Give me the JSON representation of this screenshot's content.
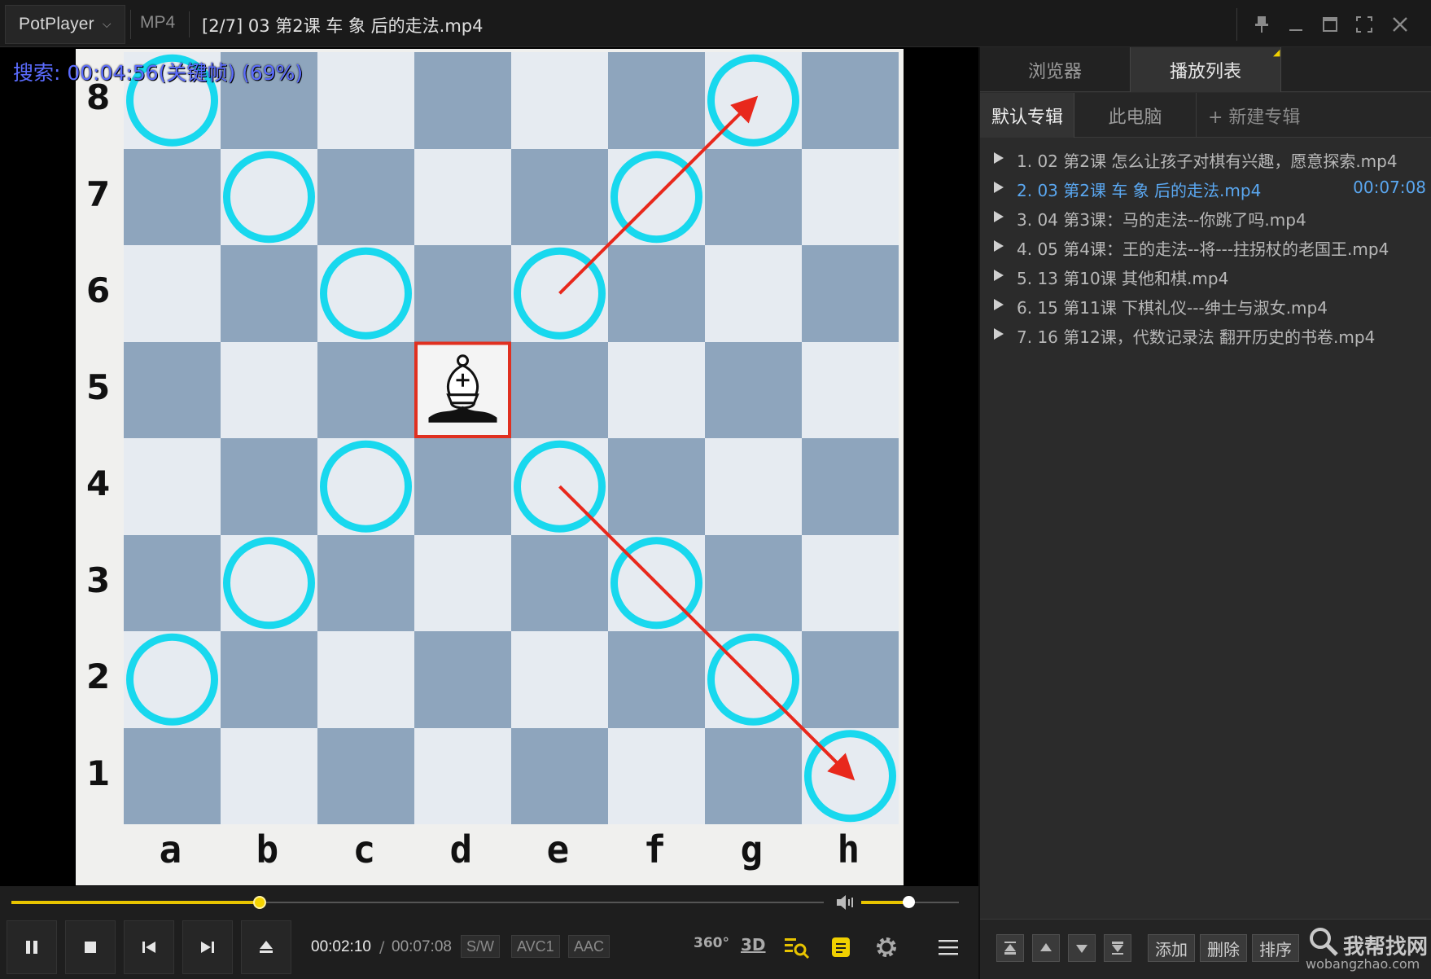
{
  "titlebar": {
    "app_name": "PotPlayer",
    "format": "MP4",
    "file_title": "[2/7] 03  第2课  车 象 后的走法.mp4"
  },
  "video": {
    "search_osd": "搜索: 00:04:56(关键帧) (69%)",
    "board": {
      "ranks": [
        "8",
        "7",
        "6",
        "5",
        "4",
        "3",
        "2",
        "1"
      ],
      "files": [
        "a",
        "b",
        "c",
        "d",
        "e",
        "f",
        "g",
        "h"
      ],
      "piece": "white-bishop",
      "piece_square": "d5",
      "highlight_color": "#e03020",
      "marker_color": "#18d8ee",
      "arrow_color": "#e8281c",
      "marked_squares": [
        "a8",
        "g8",
        "b7",
        "f7",
        "c6",
        "e6",
        "c4",
        "e4",
        "b3",
        "f3",
        "a2",
        "g2",
        "h1"
      ],
      "arrows": [
        {
          "from": "e6",
          "to": "g8"
        },
        {
          "from": "e4",
          "to": "h1"
        }
      ]
    }
  },
  "panel": {
    "tabs": {
      "browser": "浏览器",
      "playlist": "播放列表"
    },
    "album_tabs": {
      "default": "默认专辑",
      "pc": "此电脑",
      "new": "+ 新建专辑"
    },
    "playlist": [
      {
        "label": "1. 02  第2课  怎么让孩子对棋有兴趣，愿意探索.mp4",
        "duration": ""
      },
      {
        "label": "2. 03  第2课  车 象 后的走法.mp4",
        "duration": "00:07:08"
      },
      {
        "label": "3. 04  第3课：马的走法--你跳了吗.mp4",
        "duration": ""
      },
      {
        "label": "4. 05  第4课：王的走法--将---拄拐杖的老国王.mp4",
        "duration": ""
      },
      {
        "label": "5. 13  第10课    其他和棋.mp4",
        "duration": ""
      },
      {
        "label": "6. 15  第11课    下棋礼仪---绅士与淑女.mp4",
        "duration": ""
      },
      {
        "label": "7. 16  第12课，代数记录法    翻开历史的书卷.mp4",
        "duration": ""
      }
    ],
    "active_index": 1,
    "bottom": {
      "add": "添加",
      "delete": "删除",
      "sort": "排序"
    }
  },
  "controls": {
    "time_current": "00:02:10",
    "time_separator": "/",
    "time_total": "00:07:08",
    "progress_fraction": 0.306,
    "volume_fraction": 0.48,
    "codecs": [
      "S/W",
      "AVC1",
      "AAC"
    ],
    "icons": {
      "vr": "360°",
      "stereo": "3D"
    },
    "accent_color": "#e8c400"
  },
  "watermark": {
    "main": "我帮找网",
    "sub": "wobangzhao.com"
  }
}
